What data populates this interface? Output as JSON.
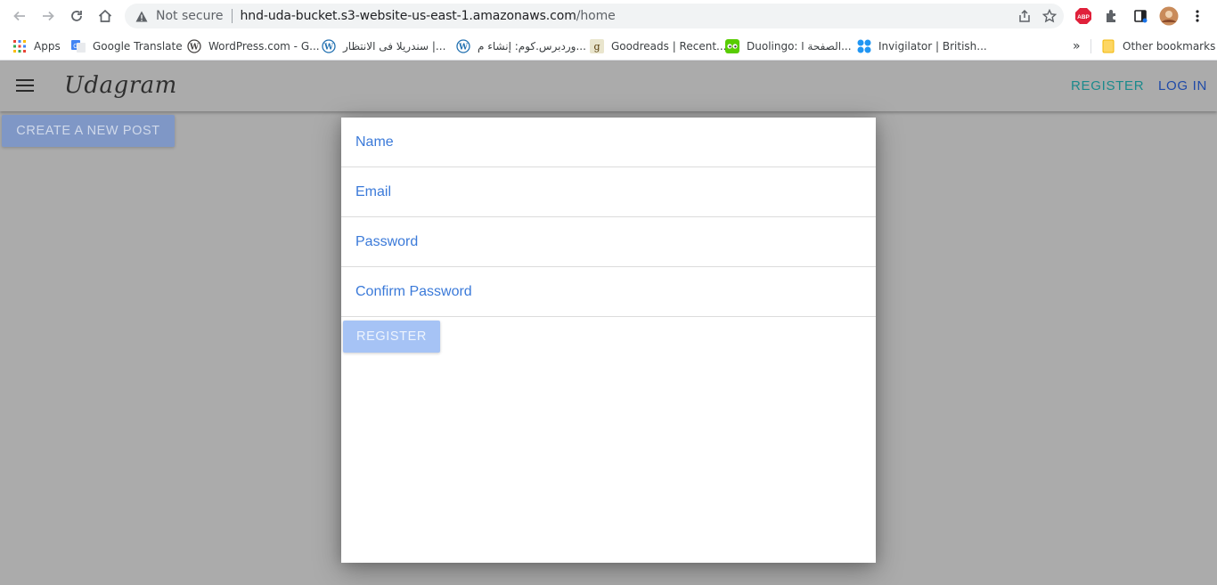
{
  "browser": {
    "security_label": "Not secure",
    "url_host": "hnd-uda-bucket.s3-website-us-east-1.amazonaws.com",
    "url_path": "/home",
    "extension_abp": "ABP"
  },
  "bookmarks": {
    "items": [
      {
        "label": "Apps",
        "icon": "apps-grid-icon"
      },
      {
        "label": "Google Translate",
        "icon": "google-translate-icon"
      },
      {
        "label": "WordPress.com - G...",
        "icon": "wordpress-icon"
      },
      {
        "label": "سندريلا فى الانتظار |...",
        "icon": "wordpress-icon"
      },
      {
        "label": "وردبرس.كوم: إنشاء م...",
        "icon": "wordpress-icon"
      },
      {
        "label": "Goodreads | Recent...",
        "icon": "goodreads-icon"
      },
      {
        "label": "Duolingo: الصفحة ا...",
        "icon": "duolingo-icon"
      },
      {
        "label": "Invigilator | British...",
        "icon": "invigilator-icon"
      }
    ],
    "overflow": "»",
    "other": "Other bookmarks"
  },
  "app": {
    "brand": "Udagram",
    "nav_register": "REGISTER",
    "nav_login": "LOG IN",
    "create_post": "CREATE A NEW POST"
  },
  "register_form": {
    "name_placeholder": "Name",
    "email_placeholder": "Email",
    "password_placeholder": "Password",
    "confirm_placeholder": "Confirm Password",
    "submit_label": "REGISTER"
  },
  "colors": {
    "backdrop": "#ababab",
    "accent_teal": "#1b8a8c",
    "accent_blue": "#1f4aa8",
    "field_text": "#3b7ad9"
  }
}
